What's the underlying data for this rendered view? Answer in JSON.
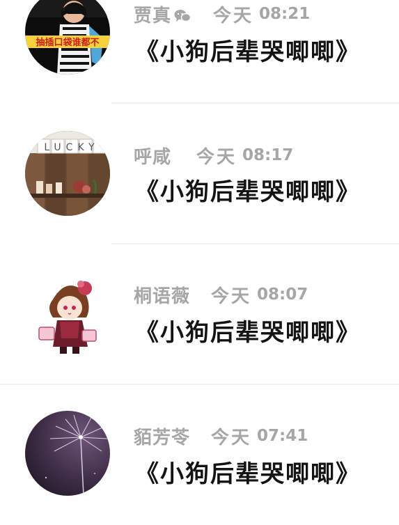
{
  "feed": {
    "items": [
      {
        "name": "贾真",
        "has_wechat_icon": true,
        "wechat_icon": "wechat-icon",
        "date": "今天",
        "time": "08:21",
        "title": "《小狗后辈哭唧唧》",
        "avatar_caption": "抽插口袋谁都不"
      },
      {
        "name": "呼咸",
        "has_wechat_icon": false,
        "date": "今天",
        "time": "08:17",
        "title": "《小狗后辈哭唧唧》",
        "avatar_caption": "LUCKY"
      },
      {
        "name": "桐语薇",
        "has_wechat_icon": false,
        "date": "今天",
        "time": "08:07",
        "title": "《小狗后辈哭唧唧》"
      },
      {
        "name": "貊芳苓",
        "has_wechat_icon": false,
        "date": "今天",
        "time": "07:41",
        "title": "《小狗后辈哭唧唧》"
      }
    ]
  },
  "colors": {
    "background": "#ffffff",
    "meta_text": "#a6a6a6",
    "title_text": "#141414",
    "divider": "#f1f1f1"
  }
}
